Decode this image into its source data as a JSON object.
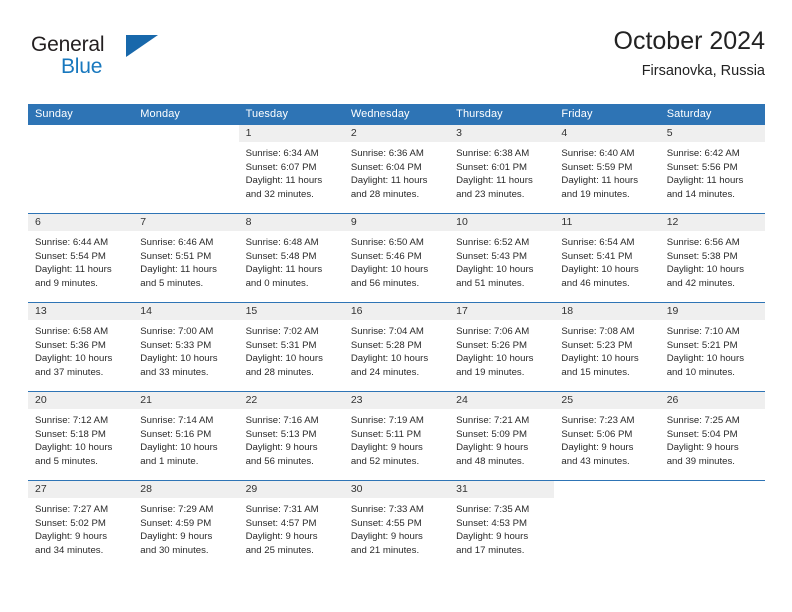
{
  "brand": {
    "name_top": "General",
    "name_bottom": "Blue",
    "triangle_color": "#1868ab",
    "blue_color": "#1878be"
  },
  "header": {
    "title": "October 2024",
    "subtitle": "Firsanovka, Russia"
  },
  "theme": {
    "header_blue": "#2e74b5",
    "day_band_gray": "#efefef",
    "text": "#222222"
  },
  "calendar": {
    "weekday_headers": [
      "Sunday",
      "Monday",
      "Tuesday",
      "Wednesday",
      "Thursday",
      "Friday",
      "Saturday"
    ],
    "labels": {
      "sunrise": "Sunrise:",
      "sunset": "Sunset:",
      "daylight": "Daylight:"
    },
    "weeks": [
      [
        {
          "day": "",
          "blank": true
        },
        {
          "day": "",
          "blank": true
        },
        {
          "day": "1",
          "sunrise": "Sunrise: 6:34 AM",
          "sunset": "Sunset: 6:07 PM",
          "daylight_1": "Daylight: 11 hours",
          "daylight_2": "and 32 minutes."
        },
        {
          "day": "2",
          "sunrise": "Sunrise: 6:36 AM",
          "sunset": "Sunset: 6:04 PM",
          "daylight_1": "Daylight: 11 hours",
          "daylight_2": "and 28 minutes."
        },
        {
          "day": "3",
          "sunrise": "Sunrise: 6:38 AM",
          "sunset": "Sunset: 6:01 PM",
          "daylight_1": "Daylight: 11 hours",
          "daylight_2": "and 23 minutes."
        },
        {
          "day": "4",
          "sunrise": "Sunrise: 6:40 AM",
          "sunset": "Sunset: 5:59 PM",
          "daylight_1": "Daylight: 11 hours",
          "daylight_2": "and 19 minutes."
        },
        {
          "day": "5",
          "sunrise": "Sunrise: 6:42 AM",
          "sunset": "Sunset: 5:56 PM",
          "daylight_1": "Daylight: 11 hours",
          "daylight_2": "and 14 minutes."
        }
      ],
      [
        {
          "day": "6",
          "sunrise": "Sunrise: 6:44 AM",
          "sunset": "Sunset: 5:54 PM",
          "daylight_1": "Daylight: 11 hours",
          "daylight_2": "and 9 minutes."
        },
        {
          "day": "7",
          "sunrise": "Sunrise: 6:46 AM",
          "sunset": "Sunset: 5:51 PM",
          "daylight_1": "Daylight: 11 hours",
          "daylight_2": "and 5 minutes."
        },
        {
          "day": "8",
          "sunrise": "Sunrise: 6:48 AM",
          "sunset": "Sunset: 5:48 PM",
          "daylight_1": "Daylight: 11 hours",
          "daylight_2": "and 0 minutes."
        },
        {
          "day": "9",
          "sunrise": "Sunrise: 6:50 AM",
          "sunset": "Sunset: 5:46 PM",
          "daylight_1": "Daylight: 10 hours",
          "daylight_2": "and 56 minutes."
        },
        {
          "day": "10",
          "sunrise": "Sunrise: 6:52 AM",
          "sunset": "Sunset: 5:43 PM",
          "daylight_1": "Daylight: 10 hours",
          "daylight_2": "and 51 minutes."
        },
        {
          "day": "11",
          "sunrise": "Sunrise: 6:54 AM",
          "sunset": "Sunset: 5:41 PM",
          "daylight_1": "Daylight: 10 hours",
          "daylight_2": "and 46 minutes."
        },
        {
          "day": "12",
          "sunrise": "Sunrise: 6:56 AM",
          "sunset": "Sunset: 5:38 PM",
          "daylight_1": "Daylight: 10 hours",
          "daylight_2": "and 42 minutes."
        }
      ],
      [
        {
          "day": "13",
          "sunrise": "Sunrise: 6:58 AM",
          "sunset": "Sunset: 5:36 PM",
          "daylight_1": "Daylight: 10 hours",
          "daylight_2": "and 37 minutes."
        },
        {
          "day": "14",
          "sunrise": "Sunrise: 7:00 AM",
          "sunset": "Sunset: 5:33 PM",
          "daylight_1": "Daylight: 10 hours",
          "daylight_2": "and 33 minutes."
        },
        {
          "day": "15",
          "sunrise": "Sunrise: 7:02 AM",
          "sunset": "Sunset: 5:31 PM",
          "daylight_1": "Daylight: 10 hours",
          "daylight_2": "and 28 minutes."
        },
        {
          "day": "16",
          "sunrise": "Sunrise: 7:04 AM",
          "sunset": "Sunset: 5:28 PM",
          "daylight_1": "Daylight: 10 hours",
          "daylight_2": "and 24 minutes."
        },
        {
          "day": "17",
          "sunrise": "Sunrise: 7:06 AM",
          "sunset": "Sunset: 5:26 PM",
          "daylight_1": "Daylight: 10 hours",
          "daylight_2": "and 19 minutes."
        },
        {
          "day": "18",
          "sunrise": "Sunrise: 7:08 AM",
          "sunset": "Sunset: 5:23 PM",
          "daylight_1": "Daylight: 10 hours",
          "daylight_2": "and 15 minutes."
        },
        {
          "day": "19",
          "sunrise": "Sunrise: 7:10 AM",
          "sunset": "Sunset: 5:21 PM",
          "daylight_1": "Daylight: 10 hours",
          "daylight_2": "and 10 minutes."
        }
      ],
      [
        {
          "day": "20",
          "sunrise": "Sunrise: 7:12 AM",
          "sunset": "Sunset: 5:18 PM",
          "daylight_1": "Daylight: 10 hours",
          "daylight_2": "and 5 minutes."
        },
        {
          "day": "21",
          "sunrise": "Sunrise: 7:14 AM",
          "sunset": "Sunset: 5:16 PM",
          "daylight_1": "Daylight: 10 hours",
          "daylight_2": "and 1 minute."
        },
        {
          "day": "22",
          "sunrise": "Sunrise: 7:16 AM",
          "sunset": "Sunset: 5:13 PM",
          "daylight_1": "Daylight: 9 hours",
          "daylight_2": "and 56 minutes."
        },
        {
          "day": "23",
          "sunrise": "Sunrise: 7:19 AM",
          "sunset": "Sunset: 5:11 PM",
          "daylight_1": "Daylight: 9 hours",
          "daylight_2": "and 52 minutes."
        },
        {
          "day": "24",
          "sunrise": "Sunrise: 7:21 AM",
          "sunset": "Sunset: 5:09 PM",
          "daylight_1": "Daylight: 9 hours",
          "daylight_2": "and 48 minutes."
        },
        {
          "day": "25",
          "sunrise": "Sunrise: 7:23 AM",
          "sunset": "Sunset: 5:06 PM",
          "daylight_1": "Daylight: 9 hours",
          "daylight_2": "and 43 minutes."
        },
        {
          "day": "26",
          "sunrise": "Sunrise: 7:25 AM",
          "sunset": "Sunset: 5:04 PM",
          "daylight_1": "Daylight: 9 hours",
          "daylight_2": "and 39 minutes."
        }
      ],
      [
        {
          "day": "27",
          "sunrise": "Sunrise: 7:27 AM",
          "sunset": "Sunset: 5:02 PM",
          "daylight_1": "Daylight: 9 hours",
          "daylight_2": "and 34 minutes."
        },
        {
          "day": "28",
          "sunrise": "Sunrise: 7:29 AM",
          "sunset": "Sunset: 4:59 PM",
          "daylight_1": "Daylight: 9 hours",
          "daylight_2": "and 30 minutes."
        },
        {
          "day": "29",
          "sunrise": "Sunrise: 7:31 AM",
          "sunset": "Sunset: 4:57 PM",
          "daylight_1": "Daylight: 9 hours",
          "daylight_2": "and 25 minutes."
        },
        {
          "day": "30",
          "sunrise": "Sunrise: 7:33 AM",
          "sunset": "Sunset: 4:55 PM",
          "daylight_1": "Daylight: 9 hours",
          "daylight_2": "and 21 minutes."
        },
        {
          "day": "31",
          "sunrise": "Sunrise: 7:35 AM",
          "sunset": "Sunset: 4:53 PM",
          "daylight_1": "Daylight: 9 hours",
          "daylight_2": "and 17 minutes."
        },
        {
          "day": "",
          "blank": true
        },
        {
          "day": "",
          "blank": true
        }
      ]
    ]
  }
}
